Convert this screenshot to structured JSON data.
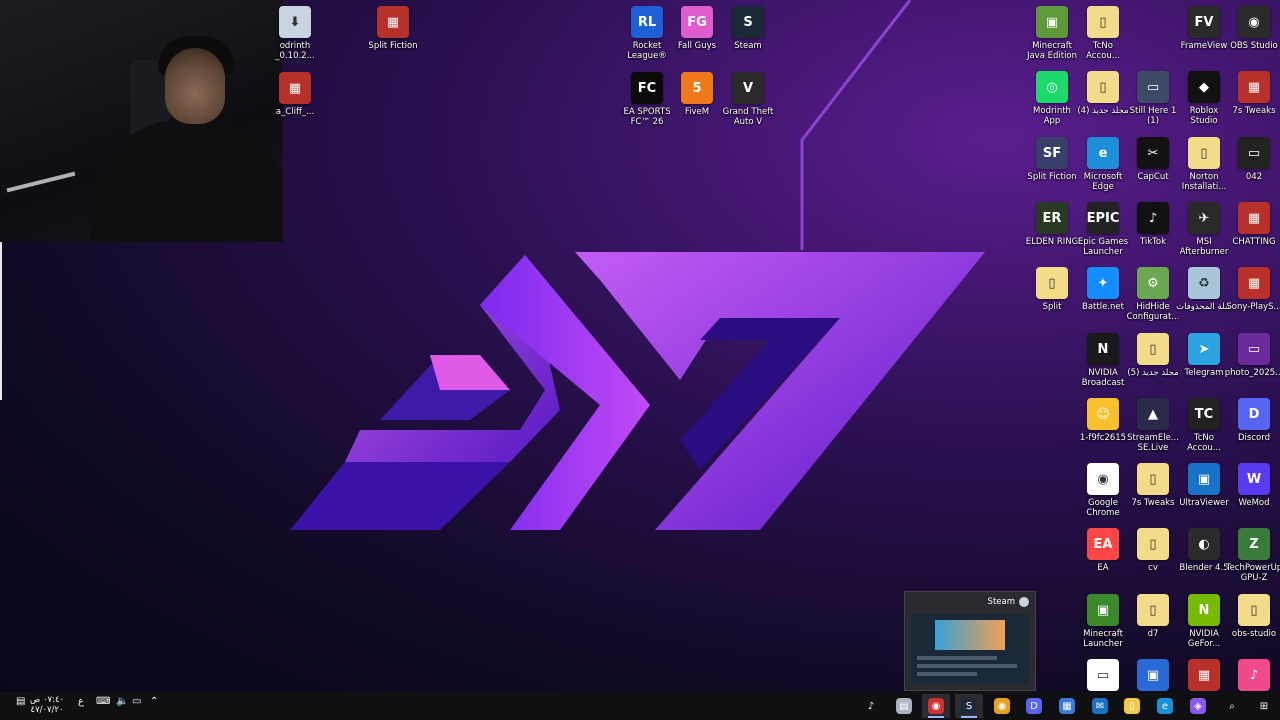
{
  "desktop": {
    "icons_top": [
      {
        "id": "modrinth-installer",
        "label": "odrinth _0.10.2...",
        "color": "#c9d4e0",
        "glyph": "⬇"
      },
      {
        "id": "split-fiction-top",
        "label": "Split Fiction",
        "color": "#b8302a",
        "glyph": "▦"
      },
      {
        "id": "archive-cliff",
        "label": "a_Cliff_...",
        "color": "#b8302a",
        "glyph": "▦"
      },
      {
        "id": "rocket-league",
        "label": "Rocket League®",
        "color": "#1d5fd6",
        "glyph": "RL"
      },
      {
        "id": "fall-guys",
        "label": "Fall Guys",
        "color": "#e05ad0",
        "glyph": "FG"
      },
      {
        "id": "steam-desktop",
        "label": "Steam",
        "color": "#1b2838",
        "glyph": "S"
      },
      {
        "id": "ea-sports-fc",
        "label": "EA SPORTS FC™ 26",
        "color": "#0b0b0b",
        "glyph": "FC"
      },
      {
        "id": "fivem",
        "label": "FiveM",
        "color": "#f07a1a",
        "glyph": "5"
      },
      {
        "id": "gta-v",
        "label": "Grand Theft Auto V",
        "color": "#2a2a2a",
        "glyph": "V"
      }
    ],
    "icons_right": [
      {
        "id": "minecraft-java",
        "label": "Minecraft Java Edition",
        "color": "#5c9a3a",
        "glyph": "▣"
      },
      {
        "id": "tcno-1",
        "label": "TcNo Accou...",
        "color": "#f2dc8a",
        "glyph": "▯"
      },
      {
        "id": "frameview",
        "label": "FrameView",
        "color": "#2a2a2a",
        "glyph": "FV"
      },
      {
        "id": "obs-studio",
        "label": "OBS Studio",
        "color": "#2b2b2b",
        "glyph": "◉"
      },
      {
        "id": "modrinth-app",
        "label": "Modrinth App",
        "color": "#1bd96a",
        "glyph": "◎"
      },
      {
        "id": "new-folder-4",
        "label": "مجلد جديد (4)",
        "color": "#f2dc8a",
        "glyph": "▯"
      },
      {
        "id": "still-here",
        "label": "Still Here 1 (1)",
        "color": "#3c4a66",
        "glyph": "▭"
      },
      {
        "id": "roblox-studio",
        "label": "Roblox Studio",
        "color": "#111111",
        "glyph": "◆"
      },
      {
        "id": "7s-tweaks-1",
        "label": "7s Tweaks",
        "color": "#b8302a",
        "glyph": "▦"
      },
      {
        "id": "split-fiction-right",
        "label": "Split Fiction",
        "color": "#3a3f6a",
        "glyph": "SF"
      },
      {
        "id": "microsoft-edge",
        "label": "Microsoft Edge",
        "color": "#1c8fd8",
        "glyph": "e"
      },
      {
        "id": "capcut",
        "label": "CapCut",
        "color": "#111111",
        "glyph": "✂"
      },
      {
        "id": "norton",
        "label": "Norton Installati...",
        "color": "#f2dc8a",
        "glyph": "▯"
      },
      {
        "id": "file-042",
        "label": "042",
        "color": "#222222",
        "glyph": "▭"
      },
      {
        "id": "elden-ring",
        "label": "ELDEN RING",
        "color": "#2a3a22",
        "glyph": "ER"
      },
      {
        "id": "epic-games",
        "label": "Epic Games Launcher",
        "color": "#222222",
        "glyph": "EPIC"
      },
      {
        "id": "tiktok",
        "label": "TikTok",
        "color": "#111111",
        "glyph": "♪"
      },
      {
        "id": "msi-afterburner",
        "label": "MSI Afterburner",
        "color": "#2a2a2a",
        "glyph": "✈"
      },
      {
        "id": "chatting",
        "label": "CHATTING",
        "color": "#b8302a",
        "glyph": "▦"
      },
      {
        "id": "split-folder",
        "label": "Split",
        "color": "#f2dc8a",
        "glyph": "▯"
      },
      {
        "id": "battle-net",
        "label": "Battle.net",
        "color": "#148eff",
        "glyph": "✦"
      },
      {
        "id": "hidhide",
        "label": "HidHide Configurat...",
        "color": "#6aa84f",
        "glyph": "⚙"
      },
      {
        "id": "recycle-bin",
        "label": "سلة المحذوفات",
        "color": "#a8c4d8",
        "glyph": "♻"
      },
      {
        "id": "sony-playstation",
        "label": "Sony-PlayS...",
        "color": "#b8302a",
        "glyph": "▦"
      },
      {
        "id": "nvidia-broadcast",
        "label": "NVIDIA Broadcast",
        "color": "#1a1a1a",
        "glyph": "N"
      },
      {
        "id": "new-folder-5",
        "label": "مجلد جديد (5)",
        "color": "#f2dc8a",
        "glyph": "▯"
      },
      {
        "id": "telegram",
        "label": "Telegram",
        "color": "#2aa3e0",
        "glyph": "➤"
      },
      {
        "id": "photo-2025",
        "label": "photo_2025...",
        "color": "#6a2a9a",
        "glyph": "▭"
      },
      {
        "id": "emoji-file",
        "label": "1-f9fc2615",
        "color": "#f7c02c",
        "glyph": "☺"
      },
      {
        "id": "streamelements",
        "label": "StreamEle... SE.Live",
        "color": "#2a2a4a",
        "glyph": "▲"
      },
      {
        "id": "tcno-2",
        "label": "TcNo Accou...",
        "color": "#222222",
        "glyph": "TC"
      },
      {
        "id": "discord",
        "label": "Discord",
        "color": "#5865f2",
        "glyph": "D"
      },
      {
        "id": "google-chrome",
        "label": "Google Chrome",
        "color": "#ffffff",
        "glyph": "◉"
      },
      {
        "id": "7s-tweaks-2",
        "label": "7s Tweaks",
        "color": "#f2dc8a",
        "glyph": "▯"
      },
      {
        "id": "ultraviewer",
        "label": "UltraViewer",
        "color": "#1a72c8",
        "glyph": "▣"
      },
      {
        "id": "wemod",
        "label": "WeMod",
        "color": "#5a3af0",
        "glyph": "W"
      },
      {
        "id": "ea-app",
        "label": "EA",
        "color": "#ff4646",
        "glyph": "EA"
      },
      {
        "id": "cv",
        "label": "cv",
        "color": "#f2dc8a",
        "glyph": "▯"
      },
      {
        "id": "blender",
        "label": "Blender 4.5",
        "color": "#2a2a2a",
        "glyph": "◐"
      },
      {
        "id": "gpu-z",
        "label": "TechPowerUp GPU-Z",
        "color": "#3a7a3a",
        "glyph": "Z"
      },
      {
        "id": "minecraft-launcher",
        "label": "Minecraft Launcher",
        "color": "#3a8a2a",
        "glyph": "▣"
      },
      {
        "id": "d7",
        "label": "d7",
        "color": "#f2dc8a",
        "glyph": "▯"
      },
      {
        "id": "nvidia-geforce",
        "label": "NVIDIA GeFor...",
        "color": "#76b900",
        "glyph": "N"
      },
      {
        "id": "obs-studio-folder",
        "label": "obs-studio",
        "color": "#f2dc8a",
        "glyph": "▯"
      },
      {
        "id": "blank-doc",
        "label": "",
        "color": "#ffffff",
        "glyph": "▭"
      },
      {
        "id": "app-blue",
        "label": "",
        "color": "#2a6ad8",
        "glyph": "▣"
      },
      {
        "id": "archive-bottom",
        "label": "",
        "color": "#b8302a",
        "glyph": "▦"
      },
      {
        "id": "itunes",
        "label": "",
        "color": "#f04a8a",
        "glyph": "♪"
      }
    ]
  },
  "steam_preview": {
    "title": "Steam"
  },
  "taskbar": {
    "clock_time": "٠٧:٤٠ ص",
    "clock_date": "٤٧/٠٧/٢٠",
    "lang": "ع",
    "apps": [
      {
        "id": "tiktok-tb",
        "color": "#111111",
        "glyph": "♪"
      },
      {
        "id": "explorer-tb",
        "color": "#aab4c0",
        "glyph": "▤"
      },
      {
        "id": "obs-tb",
        "color": "#d03030",
        "glyph": "◉"
      },
      {
        "id": "steam-tb",
        "color": "#1b2838",
        "glyph": "S"
      },
      {
        "id": "chrome-tb",
        "color": "#e8a020",
        "glyph": "◉"
      },
      {
        "id": "discord-tb",
        "color": "#5865f2",
        "glyph": "D"
      },
      {
        "id": "store-tb",
        "color": "#3a7ad8",
        "glyph": "▦"
      },
      {
        "id": "outlook-tb",
        "color": "#1a72c8",
        "glyph": "✉"
      },
      {
        "id": "folder-tb",
        "color": "#f2c84a",
        "glyph": "▯"
      },
      {
        "id": "edge-tb",
        "color": "#1c8fd8",
        "glyph": "e"
      },
      {
        "id": "copilot-tb",
        "color": "#8a5af0",
        "glyph": "◈"
      },
      {
        "id": "search-tb",
        "color": "transparent",
        "glyph": "⌕"
      },
      {
        "id": "start-tb",
        "color": "transparent",
        "glyph": "⊞"
      }
    ]
  }
}
